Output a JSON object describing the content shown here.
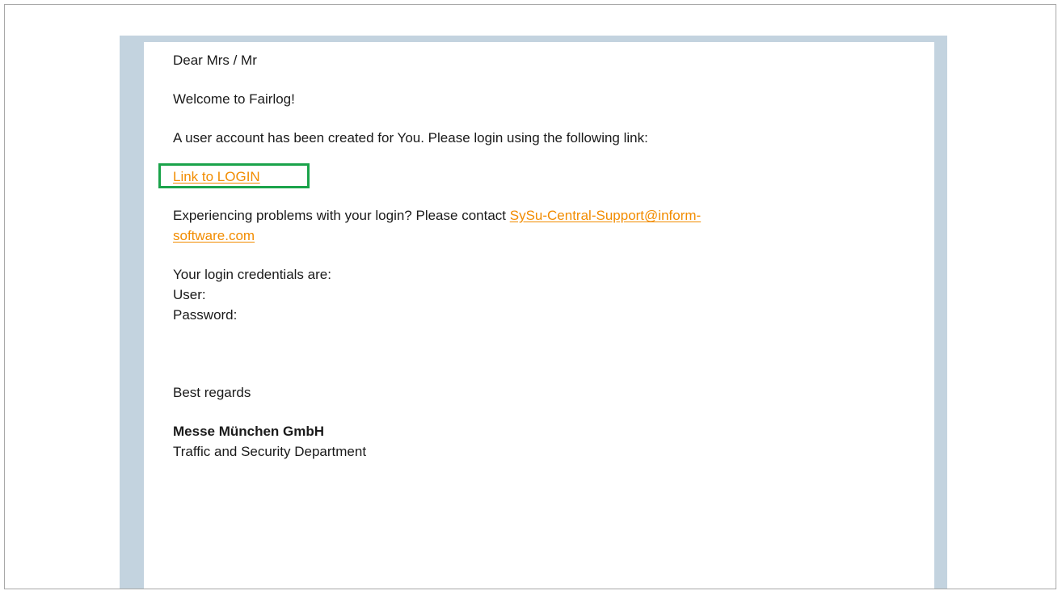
{
  "email": {
    "greeting": "Dear Mrs / Mr",
    "welcome": "Welcome to Fairlog!",
    "account_created": "A user account has been created for You. Please login using the following link:",
    "login_link_label": "Link to LOGIN",
    "problems_text": "Experiencing problems with your login? Please contact ",
    "support_email_part1": "SySu-Central-Support@inform-",
    "support_email_part2": "software.com",
    "credentials_heading": "Your login credentials are:",
    "user_label": "User:",
    "password_label": "Password:",
    "closing": "Best regards",
    "company": "Messe München GmbH",
    "department": "Traffic and Security Department"
  },
  "colors": {
    "link": "#f28c00",
    "highlight": "#1aa34a",
    "backdrop": "#c3d3df"
  }
}
